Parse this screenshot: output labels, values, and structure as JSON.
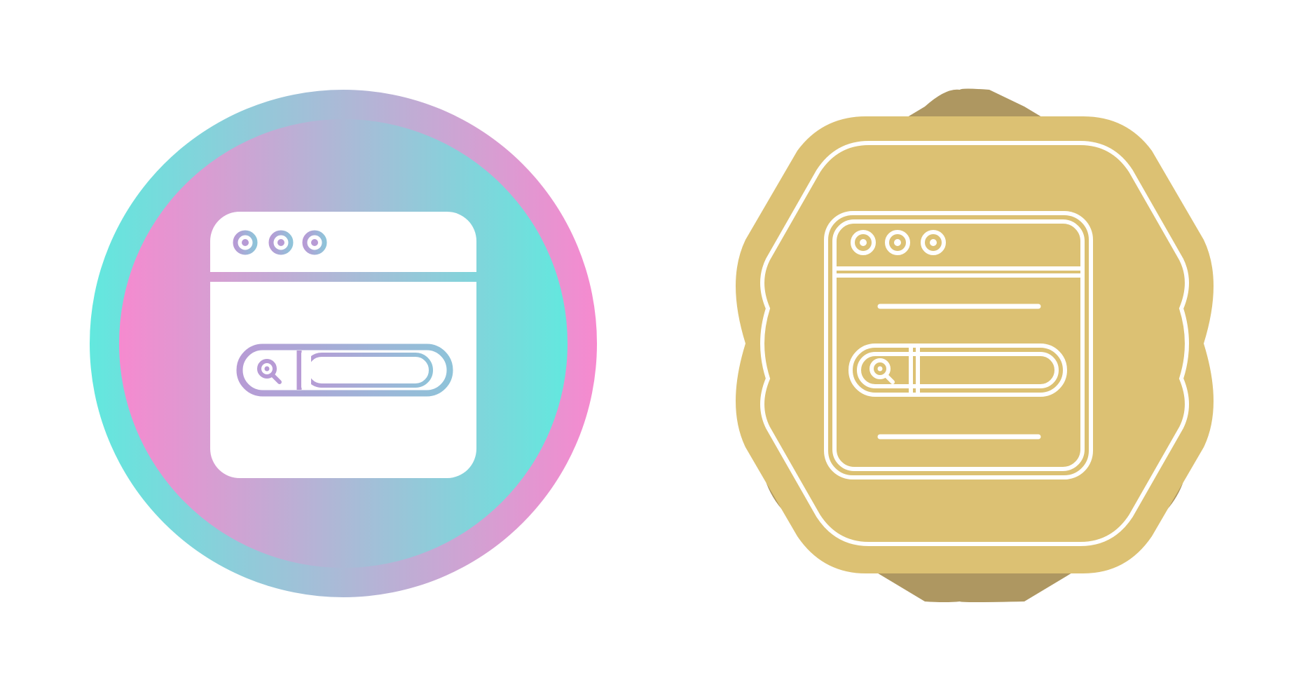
{
  "icons": [
    {
      "name": "web-search-gradient-icon",
      "style": "gradient-circle",
      "colors": {
        "teal": "#62E8DE",
        "pink": "#F68ACF",
        "purple": "#B79BD5",
        "blue": "#8FC3D9",
        "white": "#FFFFFF"
      }
    },
    {
      "name": "web-search-gold-badge-icon",
      "style": "gold-badge",
      "colors": {
        "gold": "#DCC173",
        "shadow": "#AE9761",
        "line": "#FFFFFF"
      }
    }
  ]
}
